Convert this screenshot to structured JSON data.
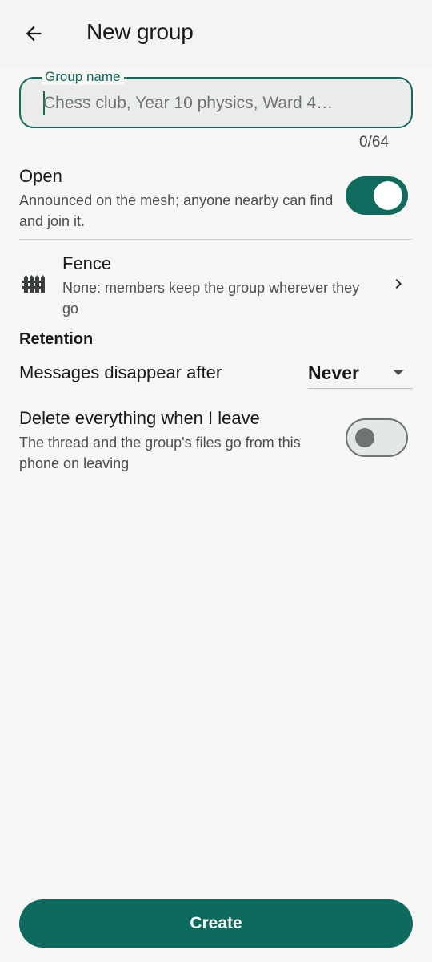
{
  "header": {
    "title": "New group",
    "back_icon": "arrow-left-icon"
  },
  "group_name": {
    "label": "Group name",
    "value": "",
    "placeholder": "Chess club, Year 10 physics, Ward 4…",
    "counter": "0/64"
  },
  "open": {
    "title": "Open",
    "description": "Announced on the mesh; anyone nearby can find and join it.",
    "enabled": true
  },
  "fence": {
    "icon": "fence-icon",
    "title": "Fence",
    "description": "None: members keep the group wherever they go",
    "chevron_icon": "chevron-right-icon"
  },
  "retention": {
    "heading": "Retention",
    "messages_label": "Messages disappear after",
    "selected": "Never"
  },
  "delete_on_leave": {
    "title": "Delete everything when I leave",
    "description": "The thread and the group's files go from this phone on leaving",
    "enabled": false
  },
  "create_button": "Create",
  "colors": {
    "accent": "#0f6b5e",
    "background": "#f6f6f4",
    "field_fill": "#e9ecea",
    "toggle_off_track": "#e3e7e5",
    "muted": "#6f7472"
  }
}
